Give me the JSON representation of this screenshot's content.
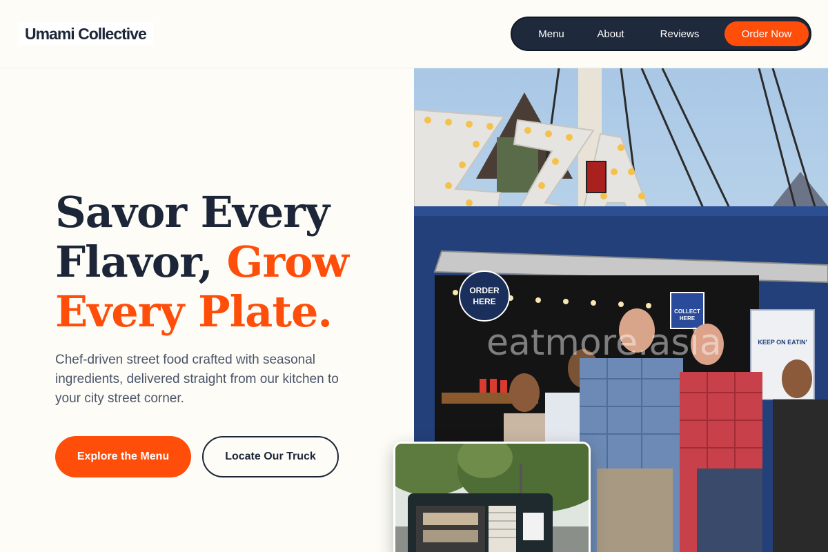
{
  "header": {
    "logo": "Umami Collective",
    "nav": {
      "menu": "Menu",
      "about": "About",
      "reviews": "Reviews",
      "order_now": "Order Now"
    }
  },
  "hero": {
    "headline_line1": "Savor Every",
    "headline_line2_dark": "Flavor,",
    "headline_line2_accent": "Grow",
    "headline_line3": "Every Plate.",
    "subtext": "Chef-driven street food crafted with seasonal ingredients, delivered straight from our kitchen to your city street corner.",
    "primary_cta": "Explore the Menu",
    "secondary_cta": "Locate Our Truck"
  },
  "photo": {
    "sign_text": "ZZA",
    "order_here": [
      "ORDER",
      "HERE"
    ],
    "collect_here": [
      "COLLECT",
      "HERE"
    ],
    "poster_text": "KEEP ON EATIN'",
    "watermark": "eatmore.asia"
  },
  "colors": {
    "accent": "#ff4d0a",
    "navy": "#1e293b",
    "background": "#fdfcf6"
  }
}
